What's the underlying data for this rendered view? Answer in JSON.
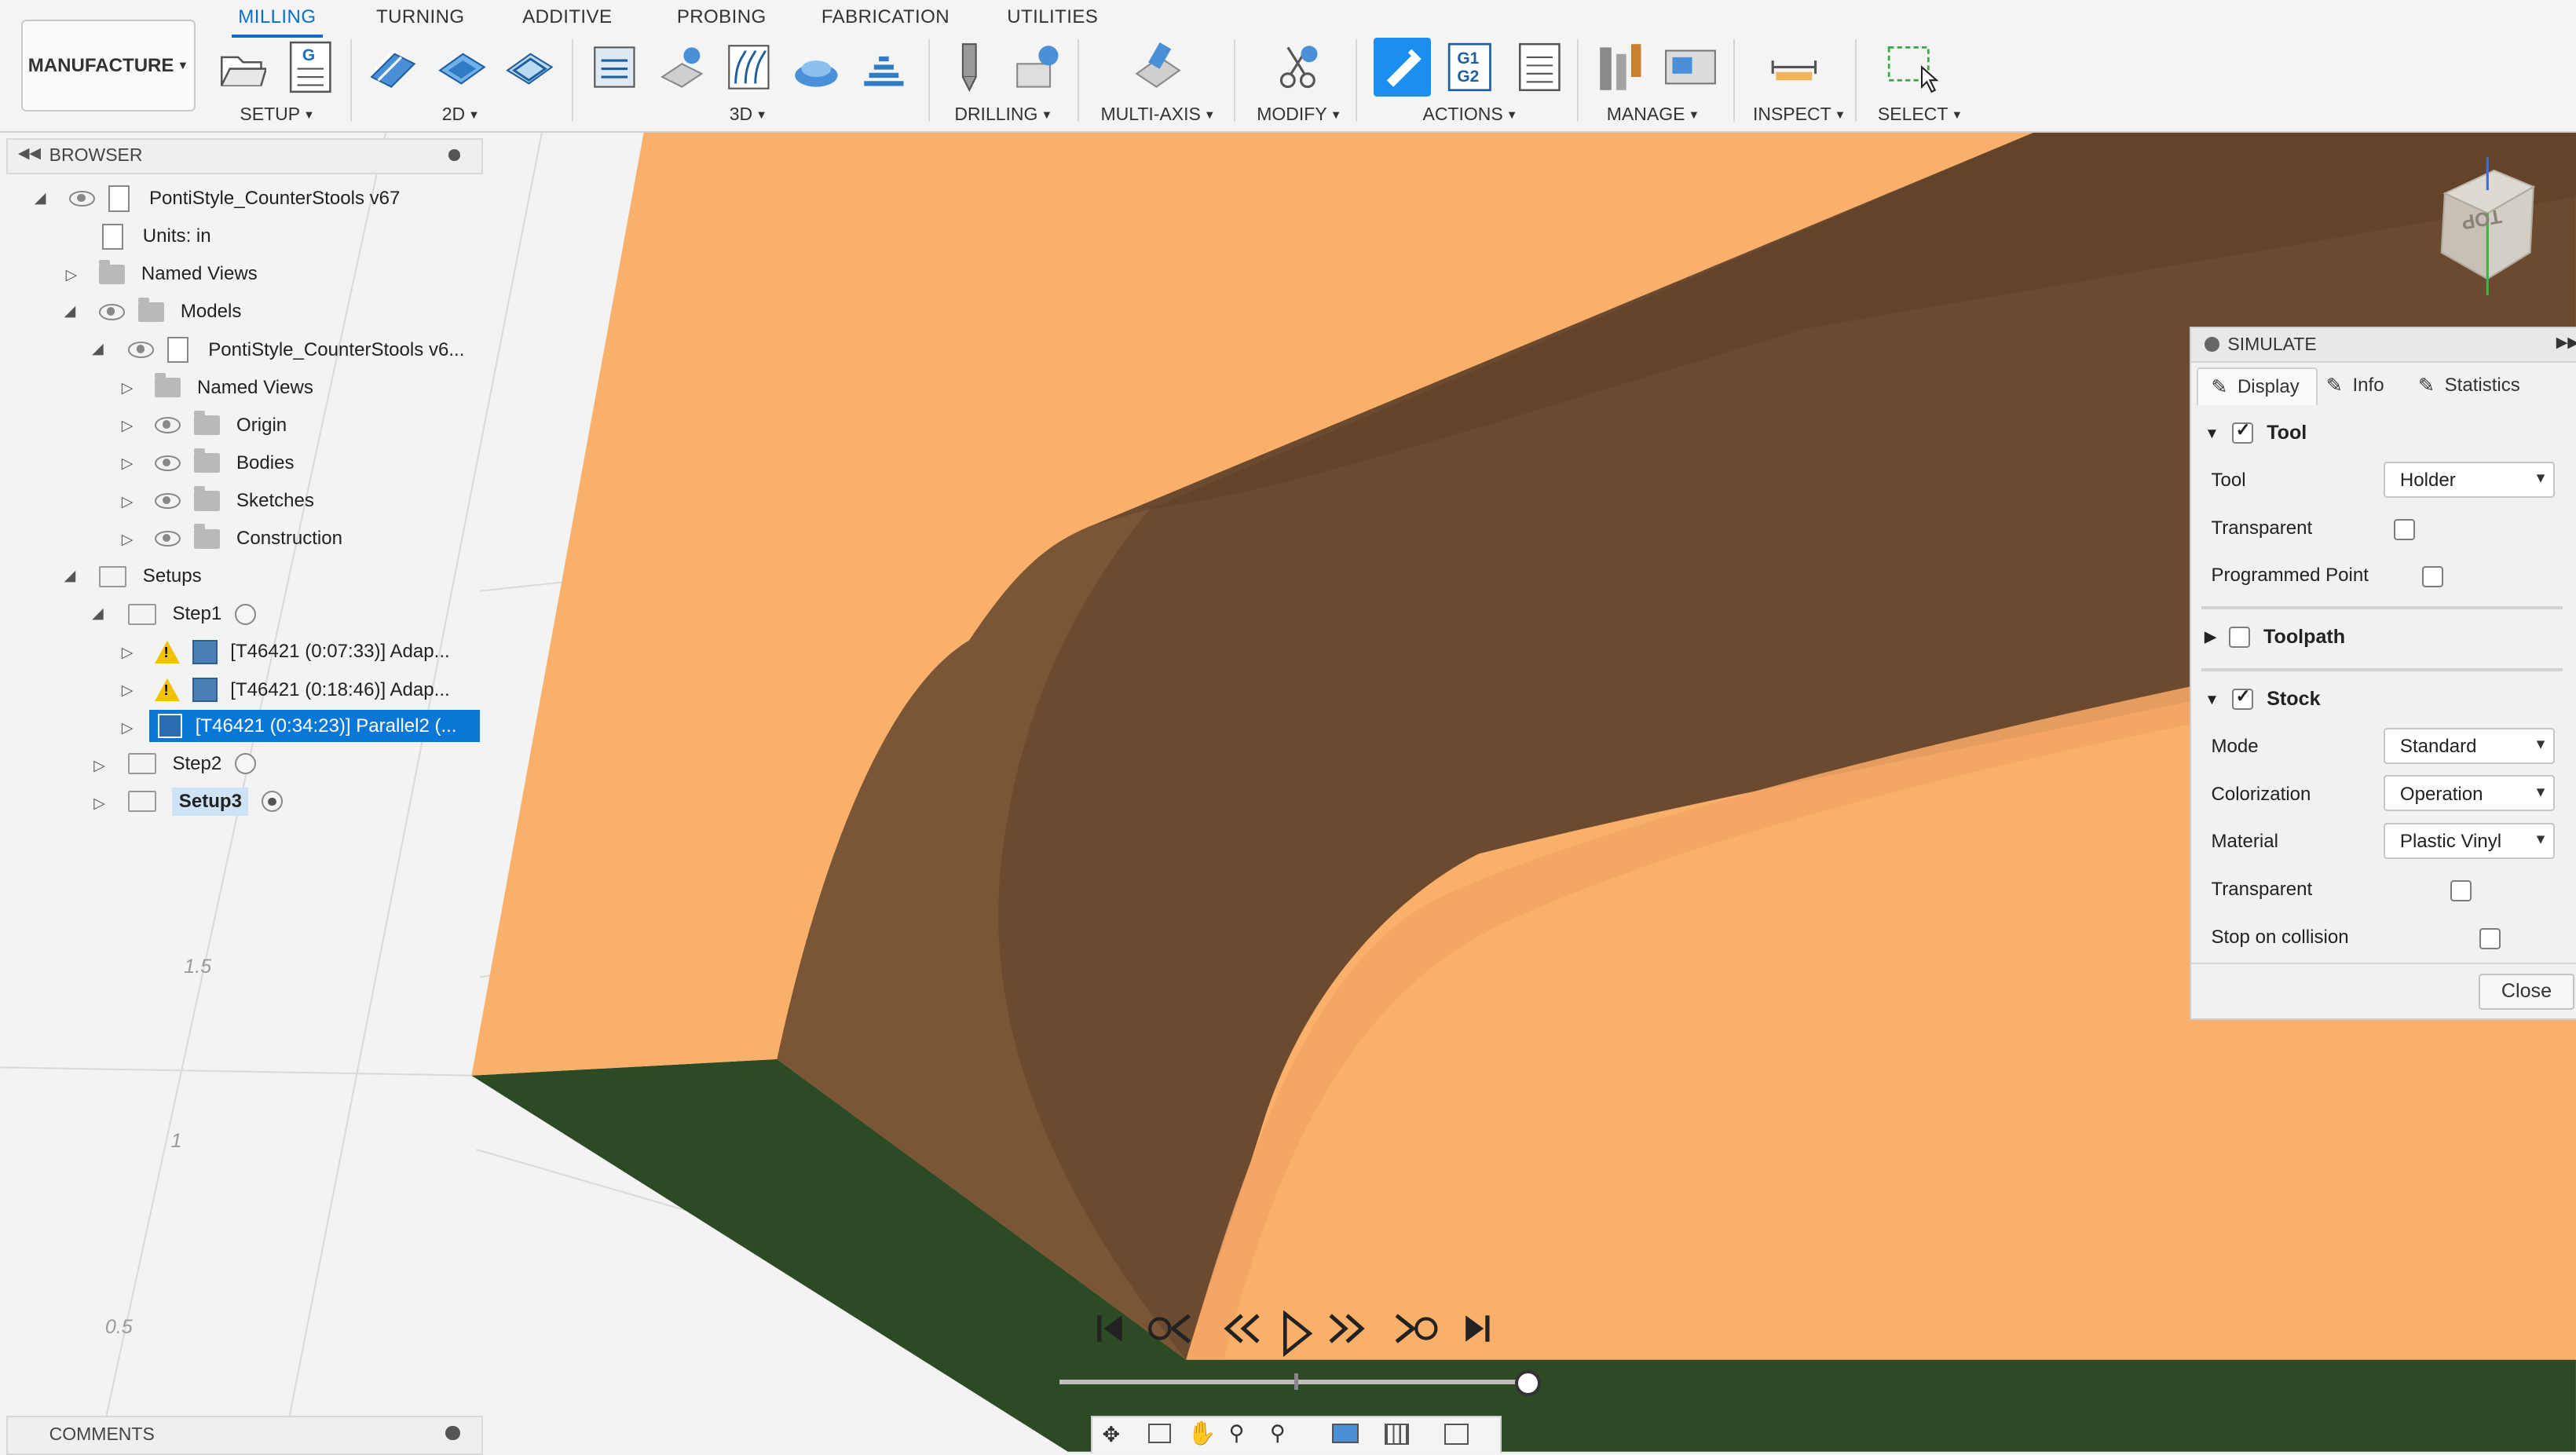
{
  "ribbon": {
    "workspace": "MANUFACTURE",
    "tabs": [
      "MILLING",
      "TURNING",
      "ADDITIVE",
      "PROBING",
      "FABRICATION",
      "UTILITIES"
    ],
    "groups": {
      "setup": "SETUP",
      "two_d": "2D",
      "three_d": "3D",
      "drilling": "DRILLING",
      "multi_axis": "MULTI-AXIS",
      "modify": "MODIFY",
      "actions": "ACTIONS",
      "manage": "MANAGE",
      "inspect": "INSPECT",
      "select": "SELECT"
    },
    "g1g2_label": "G1\nG2",
    "g_label": "G"
  },
  "browser": {
    "title": "BROWSER",
    "root": "PontiStyle_CounterStools v67",
    "units": "Units: in",
    "named_views": "Named Views",
    "models": "Models",
    "model_name": "PontiStyle_CounterStools v6...",
    "named_views_2": "Named Views",
    "origin": "Origin",
    "bodies": "Bodies",
    "sketches": "Sketches",
    "construction": "Construction",
    "setups": "Setups",
    "step1": "Step1",
    "op1": "[T46421 (0:07:33)] Adap...",
    "op2": "[T46421 (0:18:46)] Adap...",
    "op3": "[T46421 (0:34:23)] Parallel2 (...",
    "step2": "Step2",
    "setup3": "Setup3"
  },
  "comments": {
    "title": "COMMENTS"
  },
  "viewport": {
    "axis_labels": [
      "1.5",
      "1",
      "0.5"
    ],
    "viewcube_label": "TOP",
    "colors": {
      "stock": "#f9b06a",
      "cut": "#6c4a30",
      "fixture": "#2c4a24",
      "accent": "#0a6ed1"
    }
  },
  "simulate": {
    "title": "SIMULATE",
    "tabs": [
      "Display",
      "Info",
      "Statistics"
    ],
    "tool_section": "Tool",
    "tool_label": "Tool",
    "tool_value": "Holder",
    "transparent_label": "Transparent",
    "programmed_point_label": "Programmed Point",
    "toolpath_section": "Toolpath",
    "stock_section": "Stock",
    "mode_label": "Mode",
    "mode_value": "Standard",
    "colorization_label": "Colorization",
    "colorization_value": "Operation",
    "material_label": "Material",
    "material_value": "Plastic Vinyl",
    "stock_transparent_label": "Transparent",
    "stop_label": "Stop on collision",
    "close": "Close"
  },
  "playback": {
    "progress": 0.98
  }
}
